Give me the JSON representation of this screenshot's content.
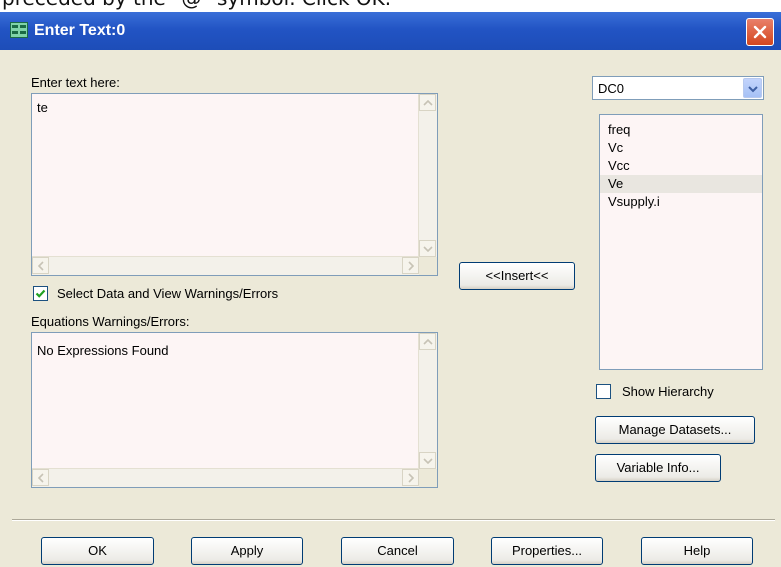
{
  "cropped_caption": "preceded by the \"@\" symbol. Click OK.",
  "window": {
    "title": "Enter Text:0"
  },
  "editor": {
    "label": "Enter text here:",
    "value": "te"
  },
  "select_data_checkbox": {
    "label": "Select Data and View Warnings/Errors",
    "checked": true
  },
  "warnings": {
    "label": "Equations Warnings/Errors:",
    "value": "No Expressions Found"
  },
  "insert_button": "<<Insert<<",
  "dataset_select": {
    "selected": "DC0"
  },
  "variables": {
    "items": [
      "freq",
      "Vc",
      "Vcc",
      "Ve",
      "Vsupply.i"
    ],
    "selected": "Ve"
  },
  "show_hierarchy": {
    "label": "Show Hierarchy",
    "checked": false
  },
  "side_buttons": {
    "manage_datasets": "Manage Datasets...",
    "variable_info": "Variable Info..."
  },
  "footer_buttons": {
    "ok": "OK",
    "apply": "Apply",
    "cancel": "Cancel",
    "properties": "Properties...",
    "help": "Help"
  },
  "colors": {
    "titlebar": "#2254c4",
    "dialog_bg": "#ece9d8",
    "field_bg": "#fdf5f5",
    "checkbox_check": "#21a121"
  }
}
